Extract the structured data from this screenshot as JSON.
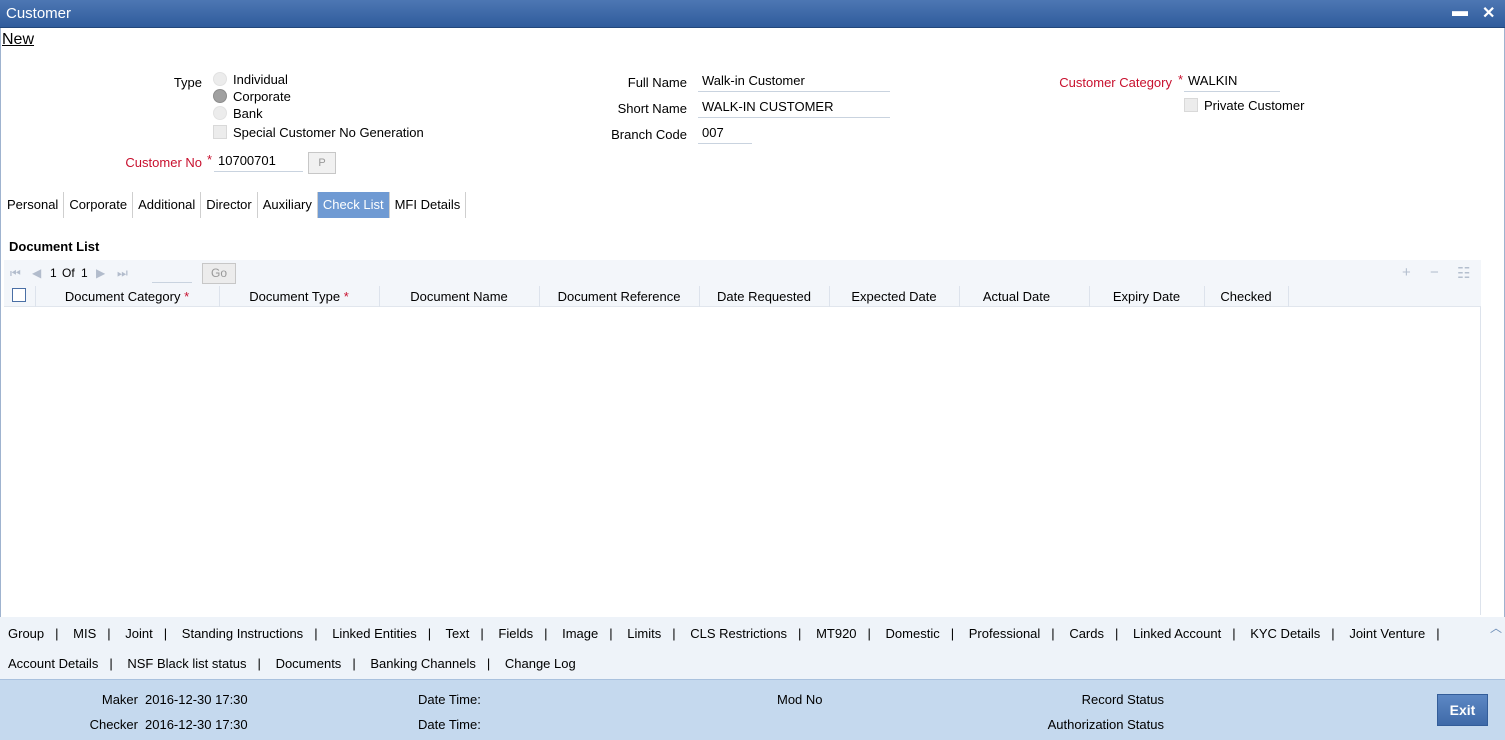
{
  "window": {
    "title": "Customer",
    "minimize": "▬",
    "close": "✕"
  },
  "toolbar": {
    "new_label": "New"
  },
  "form": {
    "type_label": "Type",
    "type_options": [
      "Individual",
      "Corporate",
      "Bank"
    ],
    "type_selected": "Corporate",
    "special_label": "Special Customer No Generation",
    "customer_no_label": "Customer No",
    "customer_no_value": "10700701",
    "p_button": "P",
    "full_name_label": "Full Name",
    "full_name_value": "Walk-in Customer",
    "short_name_label": "Short Name",
    "short_name_value": "WALK-IN CUSTOMER",
    "branch_code_label": "Branch Code",
    "branch_code_value": "007",
    "category_label": "Customer Category",
    "category_value": "WALKIN",
    "private_label": "Private Customer",
    "required_mark": "*"
  },
  "tabs": [
    "Personal",
    "Corporate",
    "Additional",
    "Director",
    "Auxiliary",
    "Check List",
    "MFI Details"
  ],
  "active_tab": "Check List",
  "document_list": {
    "title": "Document List",
    "pager": {
      "current": "1",
      "of": "Of",
      "total": "1",
      "go": "Go"
    },
    "columns": [
      "Document Category",
      "Document Type",
      "Document Name",
      "Document Reference",
      "Date Requested",
      "Expected Date",
      "Actual Date",
      "Expiry Date",
      "Checked"
    ],
    "rows": []
  },
  "footer_links_row1": [
    "Group",
    "MIS",
    "Joint",
    "Standing Instructions",
    "Linked Entities",
    "Text",
    "Fields",
    "Image",
    "Limits",
    "CLS Restrictions",
    "MT920",
    "Domestic",
    "Professional",
    "Cards",
    "Linked Account",
    "KYC Details",
    "Joint Venture"
  ],
  "footer_links_row2": [
    "Account Details",
    "NSF Black list status",
    "Documents",
    "Banking Channels",
    "Change Log"
  ],
  "status": {
    "maker_label": "Maker",
    "maker_value": "2016-12-30 17:30",
    "checker_label": "Checker",
    "checker_value": "2016-12-30 17:30",
    "date_time_label": "Date Time:",
    "mod_no_label": "Mod No",
    "record_status_label": "Record Status",
    "auth_status_label": "Authorization Status",
    "exit_label": "Exit"
  }
}
